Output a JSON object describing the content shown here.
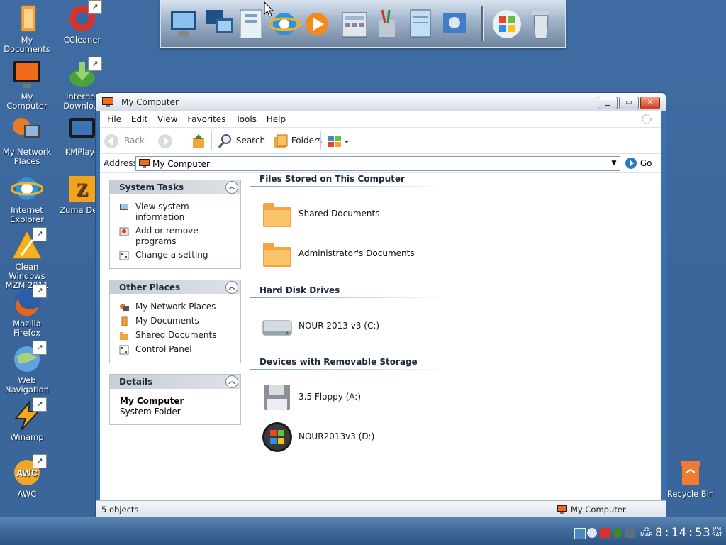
{
  "desktop": {
    "left_icons": [
      {
        "label": "My Documents"
      },
      {
        "label": "My Computer"
      },
      {
        "label": "My Network Places"
      },
      {
        "label": "Internet Explorer"
      },
      {
        "label": "Clean Windows MZM 2011"
      },
      {
        "label": "Mozilla Firefox"
      },
      {
        "label": "Web Navigation"
      },
      {
        "label": "Winamp"
      },
      {
        "label": "AWC"
      }
    ],
    "second_icons": [
      {
        "label": "CCleaner"
      },
      {
        "label": "Internet Downlo..."
      },
      {
        "label": "KMPlaye"
      },
      {
        "label": "Zuma Delu"
      }
    ],
    "recycle_bin": {
      "label": "Recycle Bin"
    }
  },
  "window": {
    "title": "My Computer",
    "menu": [
      "File",
      "Edit",
      "View",
      "Favorites",
      "Tools",
      "Help"
    ],
    "toolbar": {
      "back": "Back",
      "search": "Search",
      "folders": "Folders"
    },
    "address": {
      "label": "Address",
      "value": "My Computer",
      "go": "Go"
    },
    "tasks": {
      "system_tasks": {
        "title": "System Tasks",
        "items": [
          "View system information",
          "Add or remove programs",
          "Change a setting"
        ]
      },
      "other_places": {
        "title": "Other Places",
        "items": [
          "My Network Places",
          "My Documents",
          "Shared Documents",
          "Control Panel"
        ]
      },
      "details": {
        "title": "Details",
        "name": "My Computer",
        "type": "System Folder"
      }
    },
    "sections": {
      "files": {
        "title": "Files Stored on This Computer",
        "items": [
          "Shared Documents",
          "Administrator's Documents"
        ]
      },
      "hdd": {
        "title": "Hard Disk Drives",
        "items": [
          "NOUR 2013 v3 (C:)"
        ]
      },
      "removable": {
        "title": "Devices with Removable Storage",
        "items": [
          "3.5 Floppy (A:)",
          "NOUR2013v3 (D:)"
        ]
      }
    },
    "status": {
      "left": "5 objects",
      "right": "My Computer"
    }
  },
  "tray": {
    "date_day": "25",
    "date_month": "MAR",
    "time": "8:14:53",
    "ampm": "PM",
    "weekday": "SAT"
  },
  "colors": {
    "desktop": "#3d6a9e",
    "accent": "#3c6fae",
    "folder": "#f3a43a"
  }
}
